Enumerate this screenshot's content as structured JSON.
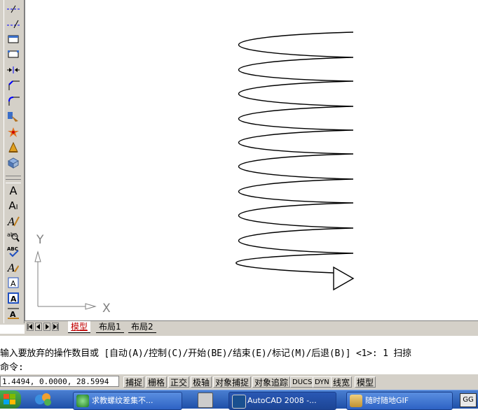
{
  "toolbar": {
    "tools": [
      {
        "name": "xline-icon",
        "glyph": "-/-"
      },
      {
        "name": "ray-icon",
        "glyph": "--/"
      },
      {
        "name": "rectangle-icon",
        "glyph": "▭"
      },
      {
        "name": "polygon-icon",
        "glyph": "▢"
      },
      {
        "name": "join-icon",
        "glyph": "→←"
      },
      {
        "name": "chamfer-icon",
        "glyph": "⌐"
      },
      {
        "name": "fillet-icon",
        "glyph": "╭"
      },
      {
        "name": "scale-icon",
        "glyph": "⤡"
      },
      {
        "name": "explode-icon",
        "glyph": "✱"
      },
      {
        "name": "purge-icon",
        "glyph": "⚐"
      },
      {
        "name": "block-icon",
        "glyph": "▦"
      }
    ],
    "text_tools": [
      {
        "name": "mtext-icon",
        "glyph": "A"
      },
      {
        "name": "dtext-icon",
        "glyph": "AI"
      },
      {
        "name": "text-edit-icon",
        "glyph": "A/"
      },
      {
        "name": "find-icon",
        "glyph": "abc"
      },
      {
        "name": "spell-check-icon",
        "glyph": "ABC"
      },
      {
        "name": "text-style-icon",
        "glyph": "A"
      },
      {
        "name": "scale-text-icon",
        "glyph": "A"
      },
      {
        "name": "justify-text-icon",
        "glyph": "A"
      },
      {
        "name": "convert-text-icon",
        "glyph": "A"
      }
    ]
  },
  "ucs": {
    "y_label": "Y",
    "x_label": "X"
  },
  "tabs": {
    "model": "模型",
    "layout1": "布局1",
    "layout2": "布局2"
  },
  "command": {
    "history": "输入要放弃的操作数目或 [自动(A)/控制(C)/开始(BE)/结束(E)/标记(M)/后退(B)] <1>: 1 扫掠",
    "prompt": "命令:"
  },
  "status": {
    "coords": "1.4494, 0.0000, 28.5994",
    "snap": "捕捉",
    "grid": "栅格",
    "ortho": "正交",
    "polar": "极轴",
    "osnap": "对象捕捉",
    "otrack": "对象追踪",
    "ducs": "DUCS",
    "dyn": "DYN",
    "lwt": "线宽",
    "model": "模型"
  },
  "taskbar": {
    "tasks": [
      {
        "label": "求教螺纹差集不..."
      },
      {
        "label": "AutoCAD 2008 -..."
      },
      {
        "label": "随时随地GIF"
      }
    ]
  },
  "colors": {
    "toolbar": "#d4d0c8",
    "canvas": "#ffffff",
    "active_tab": "#c00000",
    "taskbar": "#245edb"
  }
}
